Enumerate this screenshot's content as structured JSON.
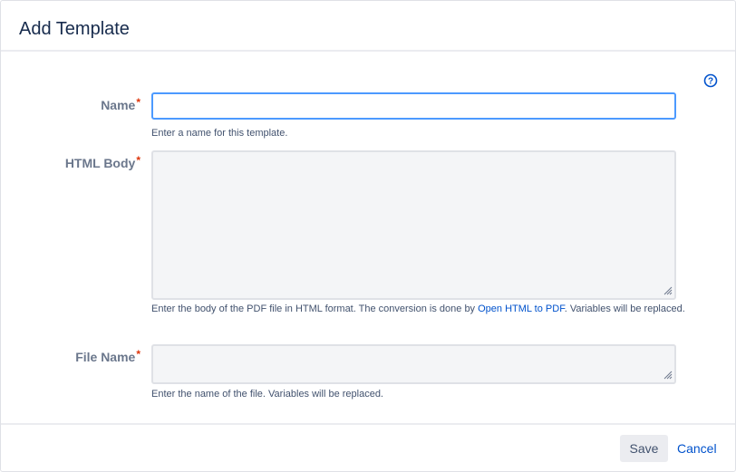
{
  "dialog": {
    "title": "Add Template"
  },
  "help": {
    "icon": "help-circle-icon",
    "color": "#0052cc"
  },
  "form": {
    "name": {
      "label": "Name",
      "required_mark": "*",
      "value": "",
      "description": "Enter a name for this template."
    },
    "html_body": {
      "label": "HTML Body",
      "required_mark": "*",
      "value": "",
      "description_before": "Enter the body of the PDF file in HTML format. The conversion is done by ",
      "description_link": "Open HTML to PDF",
      "description_after": ". Variables will be replaced."
    },
    "file_name": {
      "label": "File Name",
      "required_mark": "*",
      "value": "",
      "description": "Enter the name of the file. Variables will be replaced."
    }
  },
  "footer": {
    "save_label": "Save",
    "cancel_label": "Cancel"
  },
  "colors": {
    "link": "#0052cc",
    "required": "#de350b",
    "focus_border": "#4c9aff",
    "title": "#172b4d"
  }
}
